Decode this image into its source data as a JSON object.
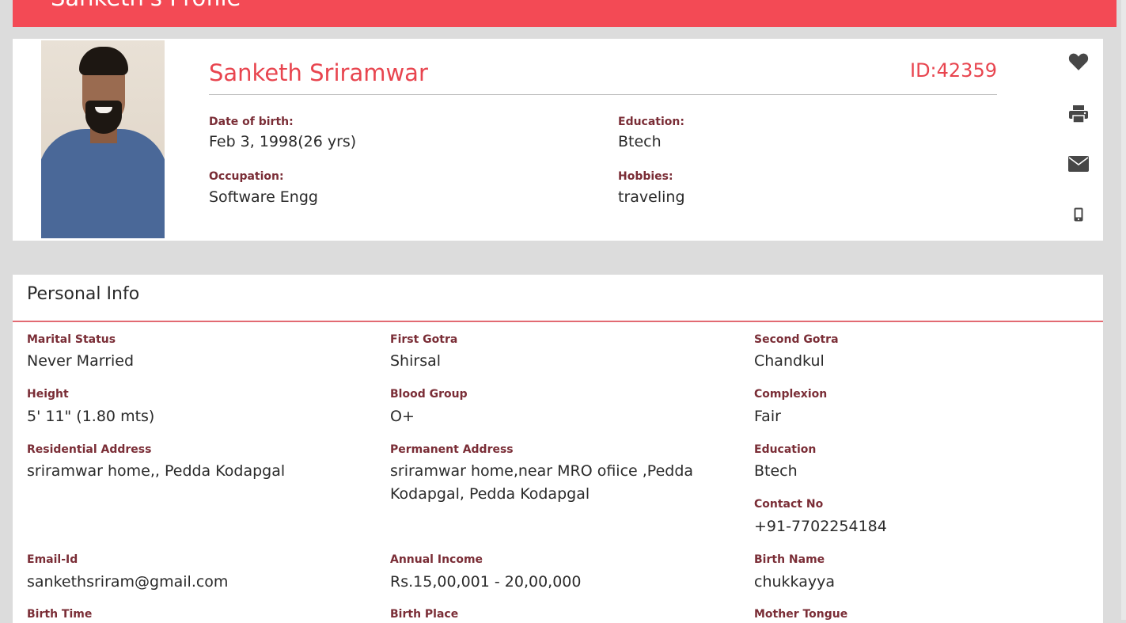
{
  "header": {
    "title": "Sanketh's Profile"
  },
  "profile": {
    "name": "Sanketh Sriramwar",
    "id_label": "ID:42359",
    "dob_label": "Date of birth:",
    "dob_value": "Feb 3, 1998(26 yrs)",
    "education_label": "Education:",
    "education_value": "Btech",
    "occupation_label": "Occupation:",
    "occupation_value": "Software Engg",
    "hobbies_label": "Hobbies:",
    "hobbies_value": "traveling"
  },
  "actions": {
    "icons": [
      "heart-icon",
      "print-icon",
      "envelope-icon",
      "mobile-phone-icon"
    ]
  },
  "personal_info": {
    "title": "Personal Info",
    "fields": [
      {
        "label": "Marital Status",
        "value": "Never Married"
      },
      {
        "label": "First Gotra",
        "value": "Shirsal"
      },
      {
        "label": "Second Gotra",
        "value": "Chandkul"
      },
      {
        "label": "Height",
        "value": "5' 11\" (1.80 mts)"
      },
      {
        "label": "Blood Group",
        "value": "O+"
      },
      {
        "label": "Complexion",
        "value": "Fair"
      },
      {
        "label": "Residential Address",
        "value": "sriramwar home,, Pedda Kodapgal"
      },
      {
        "label": "Permanent Address",
        "value": "sriramwar home,near MRO ofiice ,Pedda Kodapgal, Pedda Kodapgal"
      },
      {
        "label": "Education",
        "value": "Btech"
      },
      {
        "label": "Contact No",
        "value": "+91-7702254184"
      },
      {
        "label": "Email-Id",
        "value": "sankethsriram@gmail.com"
      },
      {
        "label": "Annual Income",
        "value": "Rs.15,00,001 - 20,00,000"
      },
      {
        "label": "Birth Name",
        "value": "chukkayya"
      },
      {
        "label": "Birth Time",
        "value": ""
      },
      {
        "label": "Birth Place",
        "value": ""
      },
      {
        "label": "Mother Tongue",
        "value": ""
      }
    ]
  },
  "colors": {
    "accent": "#f34a55",
    "name_text": "#e8454f",
    "label_text": "#7a2d36",
    "page_bg": "#dcdcdc"
  }
}
